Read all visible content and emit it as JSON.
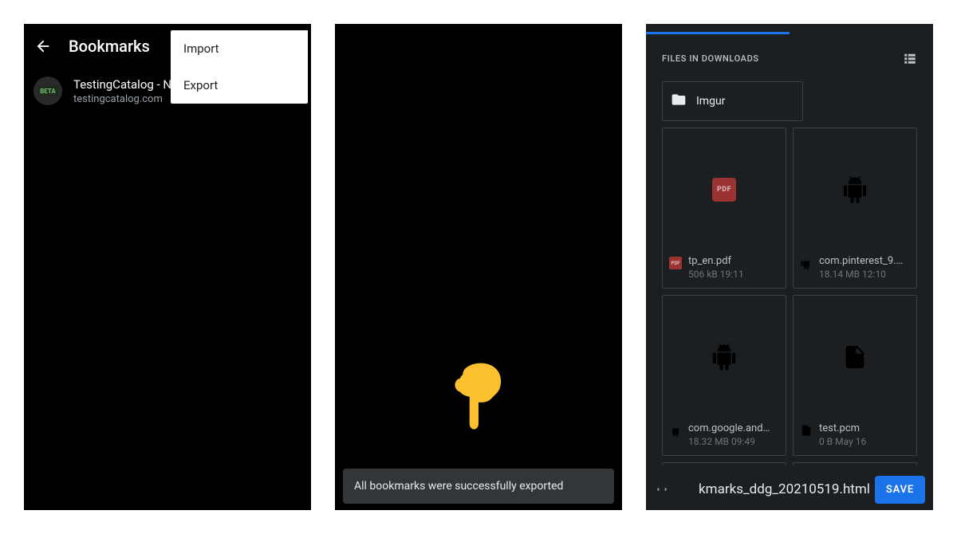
{
  "screen1": {
    "title": "Bookmarks",
    "bookmark": {
      "favicon_label": "BETA",
      "title": "TestingCatalog - Ne…",
      "subtitle": "testingcatalog.com"
    },
    "menu": {
      "import": "Import",
      "export": "Export"
    }
  },
  "screen2": {
    "toast": "All bookmarks were successfully exported"
  },
  "screen3": {
    "header": "FILES IN DOWNLOADS",
    "folder": "Imgur",
    "files": [
      {
        "name": "tp_en.pdf",
        "meta": "506 kB  19:11",
        "kind": "pdf"
      },
      {
        "name": "com.pinterest_9.…",
        "meta": "18.14 MB  12:10",
        "kind": "apk"
      },
      {
        "name": "com.google.and…",
        "meta": "18.32 MB  09:49",
        "kind": "apk"
      },
      {
        "name": "test.pcm",
        "meta": "0 B  May 16",
        "kind": "file"
      }
    ],
    "filename": "‎kmarks_ddg_20210519.html",
    "save_label": "SAVE",
    "pdf_badge": "PDF"
  }
}
